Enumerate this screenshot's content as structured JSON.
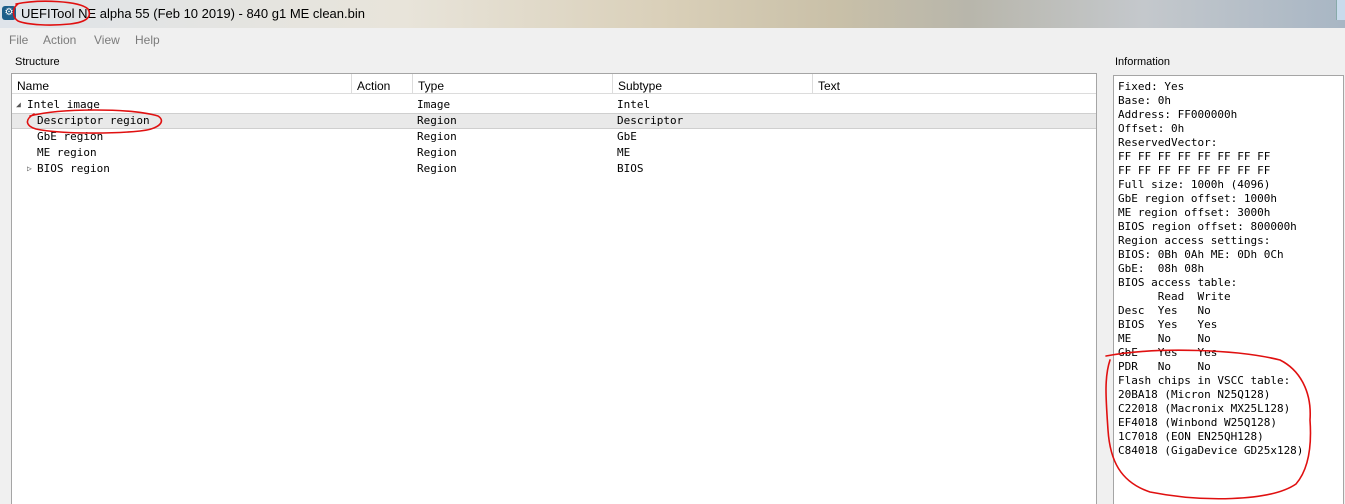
{
  "window": {
    "title": "UEFITool NE alpha 55 (Feb 10 2019) - 840 g1 ME clean.bin",
    "icon": "uefitool-app-icon"
  },
  "menu": [
    "File",
    "Action",
    "View",
    "Help"
  ],
  "structure": {
    "label": "Structure",
    "columns": [
      "Name",
      "Action",
      "Type",
      "Subtype",
      "Text"
    ],
    "rows": [
      {
        "name": "Intel image",
        "action": "",
        "type": "Image",
        "subtype": "Intel",
        "text": "",
        "expander": "expanded"
      },
      {
        "name": "Descriptor region",
        "action": "",
        "type": "Region",
        "subtype": "Descriptor",
        "text": "",
        "selected": true
      },
      {
        "name": "GbE region",
        "action": "",
        "type": "Region",
        "subtype": "GbE",
        "text": ""
      },
      {
        "name": "ME region",
        "action": "",
        "type": "Region",
        "subtype": "ME",
        "text": ""
      },
      {
        "name": "BIOS region",
        "action": "",
        "type": "Region",
        "subtype": "BIOS",
        "text": "",
        "expander": "collapsed"
      }
    ]
  },
  "information": {
    "label": "Information",
    "lines": [
      "Fixed: Yes",
      "Base: 0h",
      "Address: FF000000h",
      "Offset: 0h",
      "ReservedVector:",
      "FF FF FF FF FF FF FF FF",
      "FF FF FF FF FF FF FF FF",
      "Full size: 1000h (4096)",
      "GbE region offset: 1000h",
      "ME region offset: 3000h",
      "BIOS region offset: 800000h",
      "Region access settings:",
      "BIOS: 0Bh 0Ah ME: 0Dh 0Ch",
      "GbE:  08h 08h",
      "BIOS access table:",
      "      Read  Write",
      "Desc  Yes   No",
      "BIOS  Yes   Yes",
      "ME    No    No",
      "GbE   Yes   Yes",
      "PDR   No    No",
      "Flash chips in VSCC table:",
      "20BA18 (Micron N25Q128)",
      "C22018 (Macronix MX25L128)",
      "EF4018 (Winbond W25Q128)",
      "1C7018 (EON EN25QH128)",
      "C84018 (GigaDevice GD25x128)"
    ]
  },
  "colors": {
    "annotation": "#e01010",
    "selection": "#e9e9e9",
    "disabled_menu": "#7b7b7b"
  }
}
